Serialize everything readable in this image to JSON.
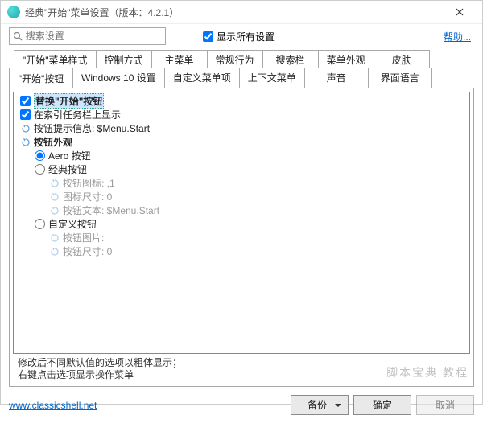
{
  "window": {
    "title": "经典\"开始\"菜单设置（版本：4.2.1）"
  },
  "search": {
    "placeholder": "搜索设置"
  },
  "showAll": {
    "label": "显示所有设置",
    "checked": true
  },
  "help": "帮助...",
  "tabs": {
    "row1": [
      "\"开始\"菜单样式",
      "控制方式",
      "主菜单",
      "常规行为",
      "搜索栏",
      "菜单外观",
      "皮肤"
    ],
    "row2": [
      "\"开始\"按钮",
      "Windows 10 设置",
      "自定义菜单项",
      "上下文菜单",
      "声音",
      "界面语言"
    ],
    "activeIndex": 0
  },
  "tree": [
    {
      "type": "check",
      "indent": 0,
      "label": "替换\"开始\"按钮",
      "checked": true,
      "bold": true,
      "highlight": true
    },
    {
      "type": "check",
      "indent": 0,
      "label": "在索引任务栏上显示",
      "checked": true
    },
    {
      "type": "reset",
      "indent": 0,
      "label": "按钮提示信息: $Menu.Start"
    },
    {
      "type": "reset",
      "indent": 0,
      "label": "按钮外观",
      "bold": true
    },
    {
      "type": "radio",
      "indent": 1,
      "label": "Aero 按钮",
      "checked": true
    },
    {
      "type": "radio",
      "indent": 1,
      "label": "经典按钮"
    },
    {
      "type": "reset",
      "indent": 2,
      "label": "按钮图标: ,1",
      "disabled": true
    },
    {
      "type": "reset",
      "indent": 2,
      "label": "图标尺寸: 0",
      "disabled": true
    },
    {
      "type": "reset",
      "indent": 2,
      "label": "按钮文本: $Menu.Start",
      "disabled": true
    },
    {
      "type": "radio",
      "indent": 1,
      "label": "自定义按钮"
    },
    {
      "type": "reset",
      "indent": 2,
      "label": "按钮图片:",
      "disabled": true
    },
    {
      "type": "reset",
      "indent": 2,
      "label": "按钮尺寸: 0",
      "disabled": true
    }
  ],
  "hint1": "修改后不同默认值的选项以粗体显示；",
  "hint2": "右键点击选项显示操作菜单",
  "footer": {
    "link": "www.classicshell.net",
    "backup": "备份",
    "ok": "确定",
    "cancel": "取消"
  },
  "watermark": "脚本宝典 教程"
}
